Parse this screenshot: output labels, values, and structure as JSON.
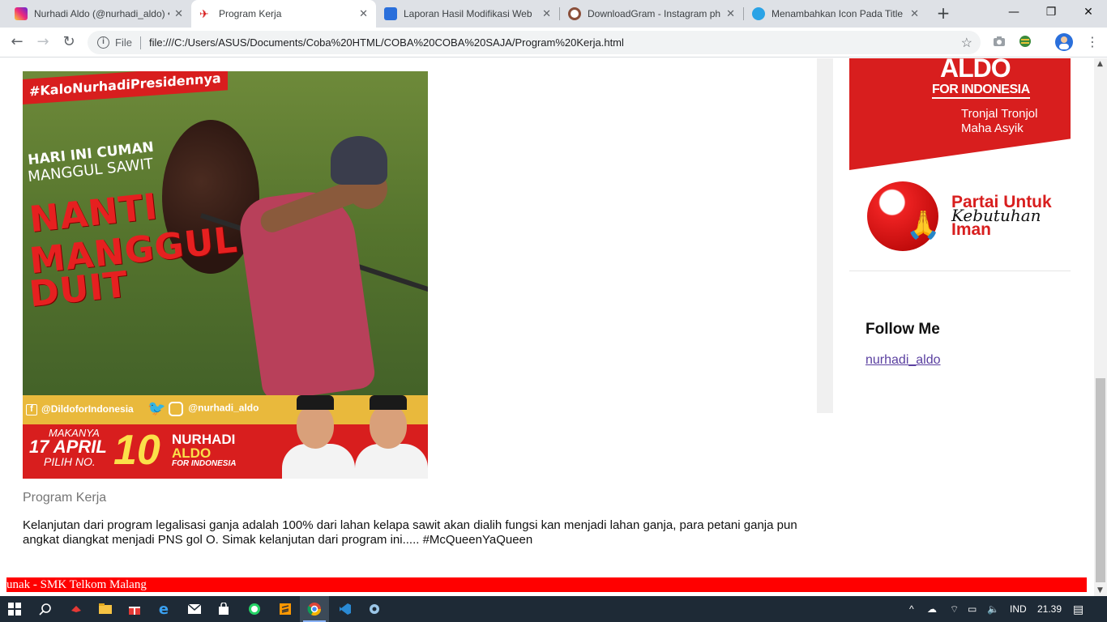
{
  "browser": {
    "tabs": [
      {
        "title": "Nurhadi Aldo (@nurhadi_aldo) •",
        "favicon": "instagram-icon",
        "color": "#d6249f",
        "active": false
      },
      {
        "title": "Program Kerja",
        "favicon": "bird-icon",
        "color": "#d81e1e",
        "active": true
      },
      {
        "title": "Laporan Hasil Modifikasi Web",
        "favicon": "contact-card-icon",
        "color": "#2a6fdb",
        "active": false
      },
      {
        "title": "DownloadGram - Instagram ph",
        "favicon": "instagram-icon",
        "color": "#8a4f3a",
        "active": false
      },
      {
        "title": "Menambahkan Icon Pada Title",
        "favicon": "kite-icon",
        "color": "#2aa3e6",
        "active": false
      }
    ],
    "new_tab": "+",
    "window_controls": {
      "minimize": "—",
      "maximize": "❐",
      "close": "✕"
    },
    "nav": {
      "back": "←",
      "forward": "→",
      "reload": "↻"
    },
    "address": {
      "scheme_label": "File",
      "url": "file:///C:/Users/ASUS/Documents/Coba%20HTML/COBA%20COBA%20SAJA/Program%20Kerja.html",
      "bookmark_icon": "☆"
    }
  },
  "page": {
    "poster": {
      "hashtag": "#KaloNurhadiPresidennya",
      "line1": "HARI INI CUMAN",
      "line2": "MANGGUL SAWIT",
      "big1": "NANTI",
      "big2": "MANGGUL",
      "big3": "DUIT",
      "facebook_handle": "@DildoforIndonesia",
      "instagram_handle": "@nurhadi_aldo",
      "date_top": "MAKANYA",
      "date_main": "17 APRIL",
      "date_bottom": "PILIH NO.",
      "number": "10",
      "name1": "NURHADI",
      "name2": "ALDO",
      "name_sub": "FOR INDONESIA"
    },
    "caption": "Program Kerja",
    "article": "Kelanjutan dari program legalisasi ganja adalah 100% dari lahan kelapa sawit akan dialih fungsi kan menjadi lahan ganja, para petani ganja pun angkat diangkat menjadi PNS gol O. Simak kelanjutan dari program ini..... #McQueenYaQueen",
    "sidebar": {
      "banner": {
        "name": "ALDO",
        "sub": "FOR INDONESIA",
        "tagline1": "Tronjal Tronjol",
        "tagline2": "Maha Asyik"
      },
      "party": {
        "line1": "Partai Untuk",
        "line2": "Kebutuhan",
        "line3": "Iman"
      },
      "follow_title": "Follow Me",
      "follow_link": "nurhadi_aldo"
    },
    "marquee": "unak - SMK Telkom Malang"
  },
  "taskbar": {
    "language": "IND",
    "time": "21.39"
  }
}
